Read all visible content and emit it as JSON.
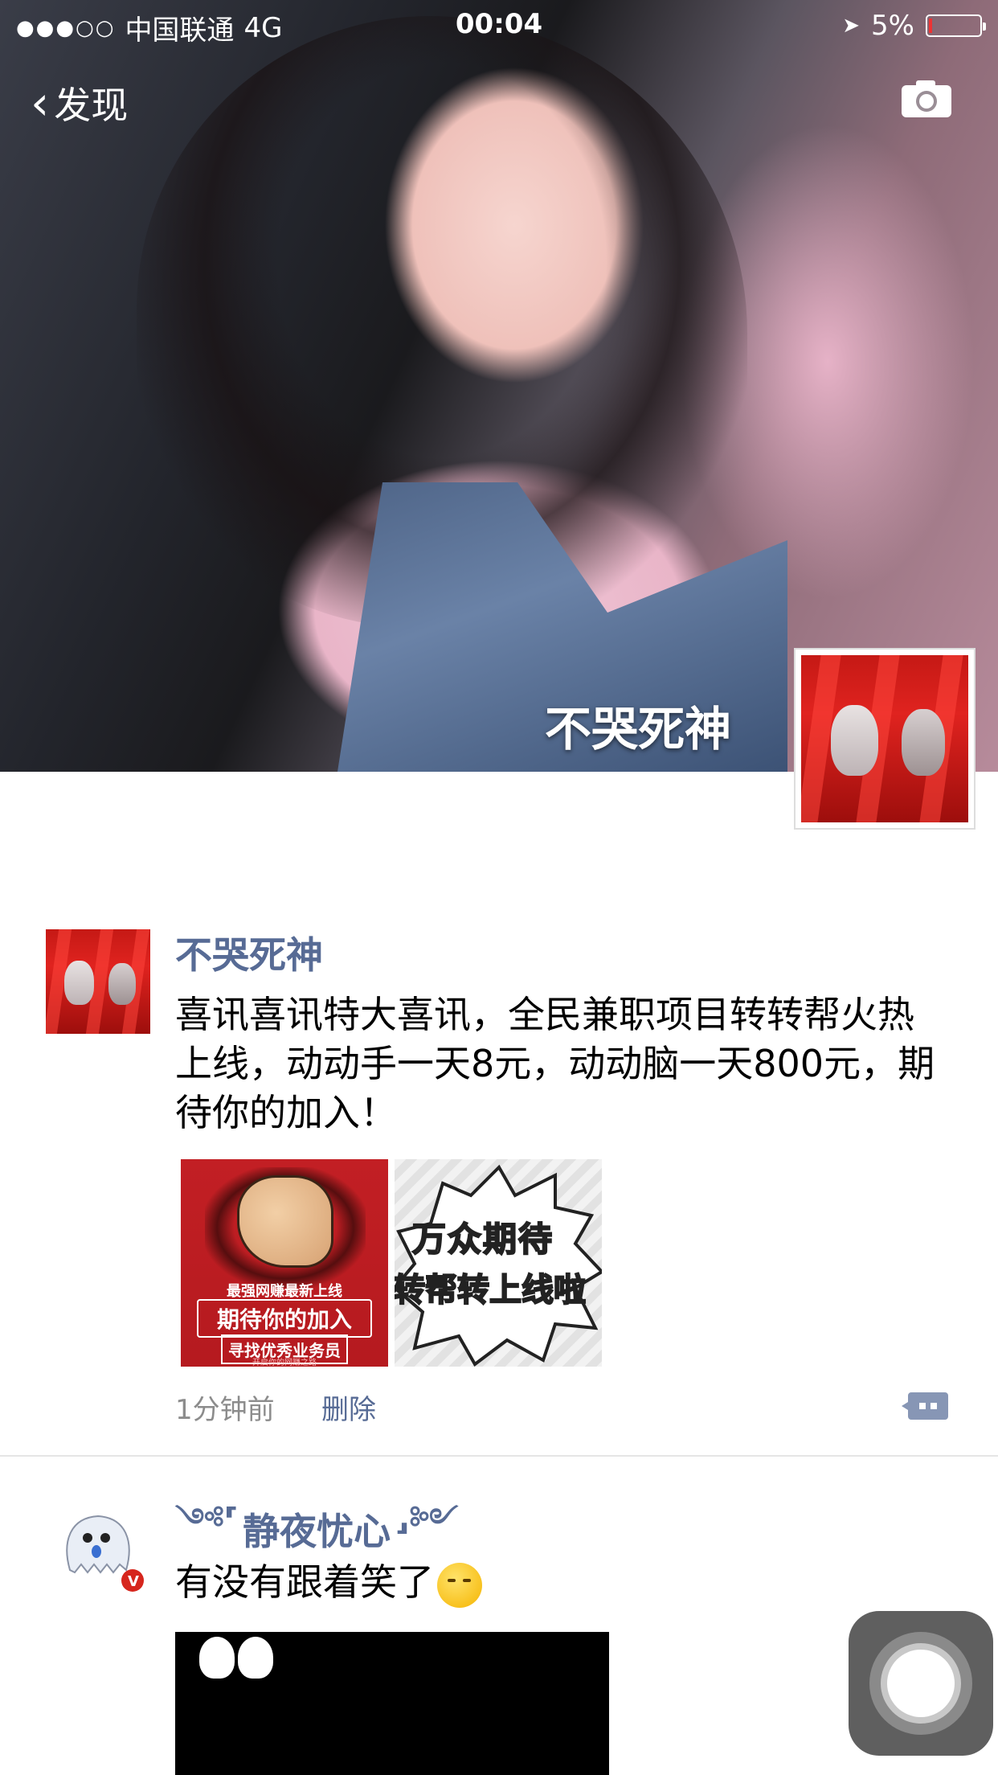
{
  "status_bar": {
    "signal": "●●●○○",
    "carrier": "中国联通",
    "network": "4G",
    "time": "00:04",
    "location_icon": "location-arrow-icon",
    "battery_percent": "5%",
    "battery_level": 0.05
  },
  "nav": {
    "back_label": "发现",
    "back_icon": "chevron-left-icon",
    "camera_icon": "camera-icon"
  },
  "cover": {
    "user_name": "不哭死神"
  },
  "posts": [
    {
      "author": "不哭死神",
      "text": "喜讯喜讯特大喜讯，全民兼职项目转转帮火热上线，动动手一天8元，动动脑一天800元，期待你的加入！",
      "images": [
        {
          "line1": "最强网赚最新上线",
          "line2": "期待你的加入",
          "line3": "寻找优秀业务员",
          "line4": "开启你的网赚之路"
        },
        {
          "line1": "万众期待",
          "line2": "转帮转上线啦"
        }
      ],
      "time": "1分钟前",
      "delete_label": "删除",
      "comment_icon": "comment-bubble-icon"
    },
    {
      "author": "静夜忧心",
      "author_ornament_left": "༺⸢",
      "author_ornament_right": "⸥༻",
      "text": "有没有跟着笑了",
      "emoji": "smirk-emoji-icon"
    }
  ],
  "assistive_touch_icon": "assistive-touch-icon",
  "colors": {
    "link": "#576b95",
    "muted": "#8c8c8c",
    "divider": "#e5e5e5"
  }
}
